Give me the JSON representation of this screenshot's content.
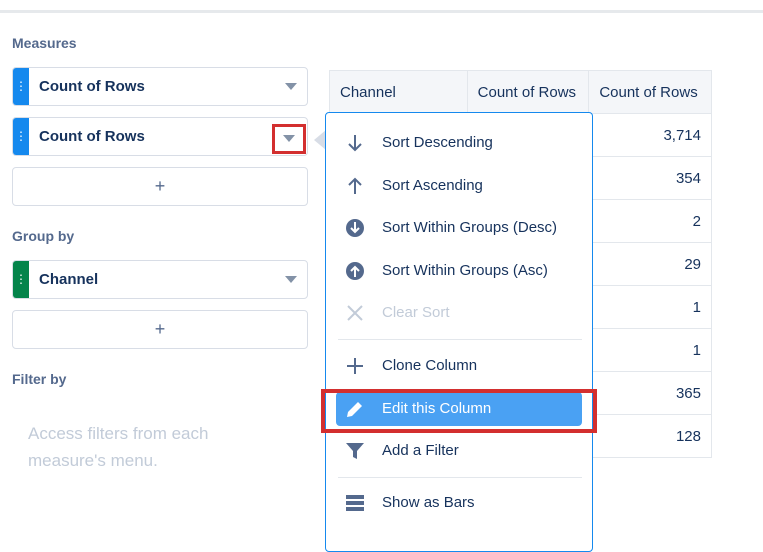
{
  "sections": {
    "measures": "Measures",
    "group_by": "Group by",
    "filter_by": "Filter by"
  },
  "measures": [
    {
      "label": "Count of Rows"
    },
    {
      "label": "Count of Rows"
    }
  ],
  "group_by": [
    {
      "label": "Channel"
    }
  ],
  "add_label": "+",
  "filter_hint": "Access filters from each measure's menu.",
  "table": {
    "headers": [
      "Channel",
      "Count of Rows",
      "Count of Rows"
    ],
    "values": [
      "3,714",
      "354",
      "2",
      "29",
      "1",
      "1",
      "365",
      "128"
    ]
  },
  "menu": {
    "items": [
      {
        "label": "Sort Descending",
        "icon": "arrow-down-icon"
      },
      {
        "label": "Sort Ascending",
        "icon": "arrow-up-icon"
      },
      {
        "label": "Sort Within Groups (Desc)",
        "icon": "circle-arrow-down-icon"
      },
      {
        "label": "Sort Within Groups (Asc)",
        "icon": "circle-arrow-up-icon"
      },
      {
        "label": "Clear Sort",
        "icon": "close-icon",
        "disabled": true
      },
      {
        "label": "Clone Column",
        "icon": "plus-icon"
      },
      {
        "label": "Edit this Column",
        "icon": "pencil-icon",
        "active": true
      },
      {
        "label": "Add a Filter",
        "icon": "funnel-icon"
      },
      {
        "label": "Show as Bars",
        "icon": "bars-icon"
      }
    ]
  },
  "colors": {
    "accent": "#1589ee",
    "group_handle": "#04844b",
    "highlight_border": "#d32f2f",
    "active_item": "#4aa1f3"
  }
}
